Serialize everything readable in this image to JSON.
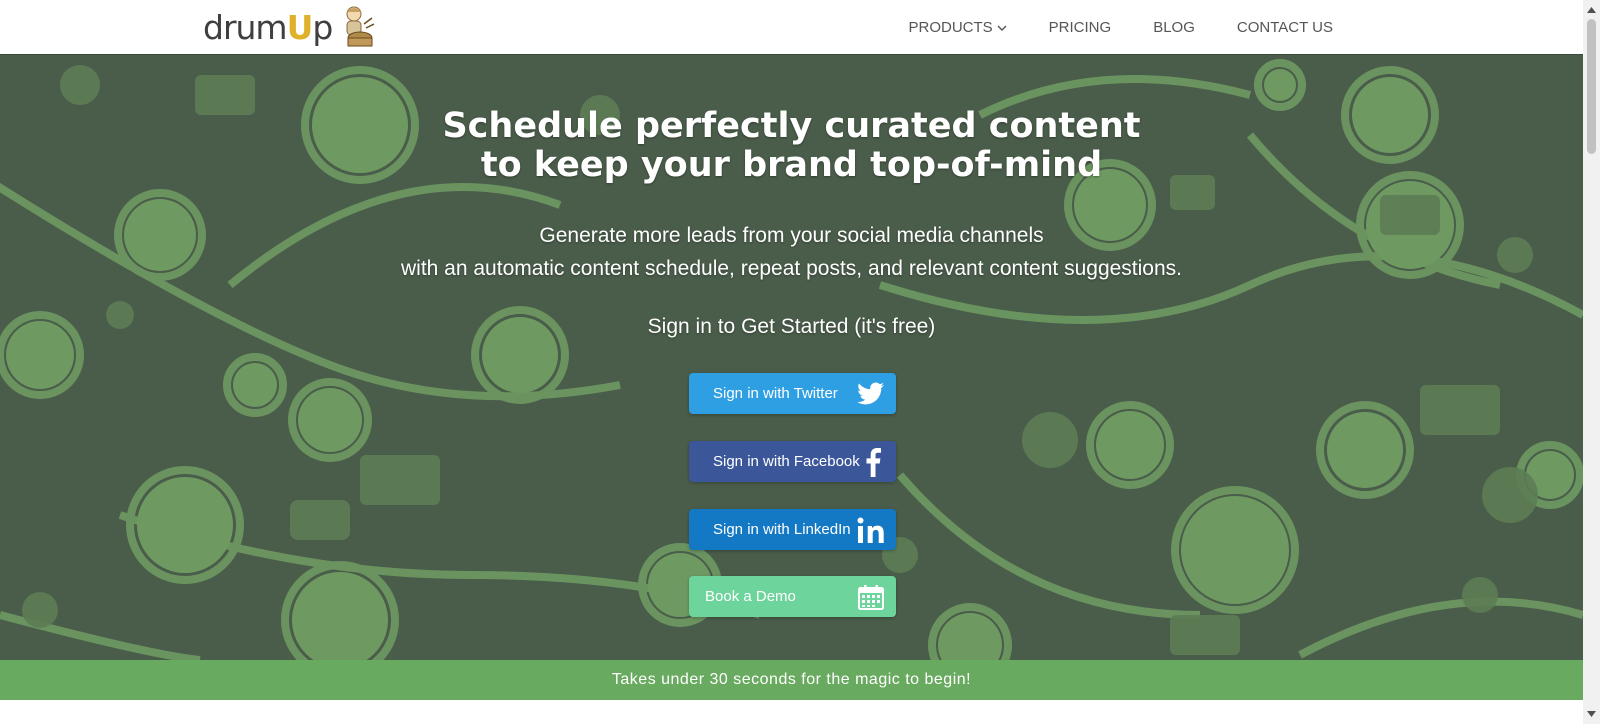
{
  "header": {
    "logo_text_before": "drum",
    "logo_text_u": "U",
    "logo_text_after": "p",
    "nav": [
      {
        "label": "PRODUCTS",
        "has_dropdown": true
      },
      {
        "label": "PRICING"
      },
      {
        "label": "BLOG"
      },
      {
        "label": "CONTACT US"
      }
    ]
  },
  "hero": {
    "title_line1": "Schedule perfectly curated content",
    "title_line2": "to keep your brand top-of-mind",
    "subtitle_line1": "Generate more leads from your social media channels",
    "subtitle_line2": "with an automatic content schedule, repeat posts, and relevant content suggestions.",
    "cta_text": "Sign in to Get Started (it's free)",
    "buttons": {
      "twitter": {
        "label": "Sign in with Twitter",
        "icon": "twitter-bird-icon",
        "color": "#2f9fe3"
      },
      "facebook": {
        "label": "Sign in with Facebook",
        "icon": "facebook-f-icon",
        "color": "#3b5799"
      },
      "linkedin": {
        "label": "Sign in with LinkedIn",
        "icon": "linkedin-in-icon",
        "color": "#1479c4"
      },
      "demo": {
        "label": "Book a Demo",
        "icon": "calendar-icon",
        "color": "#6dd49b"
      }
    }
  },
  "banner": {
    "text": "Takes under 30 seconds for the magic to begin!",
    "color": "#68aa5f"
  },
  "colors": {
    "hero_background": "#4a5c4a",
    "pattern": "#6e9a62"
  }
}
